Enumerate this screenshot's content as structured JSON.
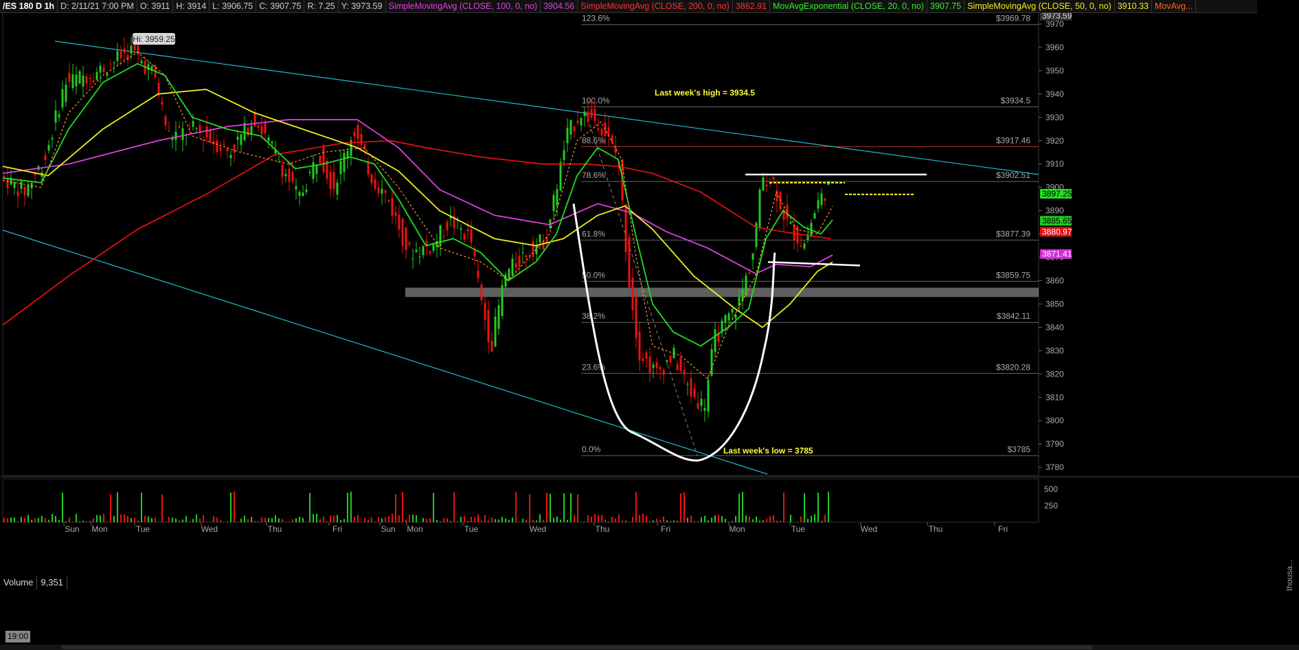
{
  "header": {
    "symbol": "/ES 180 D 1h",
    "date": "D: 2/11/21 7:00 PM",
    "open": "O: 3911",
    "high": "H: 3914",
    "low": "L: 3906.75",
    "close": "C: 3907.75",
    "range": "R: 7.25",
    "y": "Y: 3973.59",
    "sma100_label": "SimpleMovingAvg (CLOSE, 100, 0, no)",
    "sma100_value": "3904.56",
    "sma200_label": "SimpleMovingAvg (CLOSE, 200, 0, no)",
    "sma200_value": "3862.91",
    "ema20_label": "MovAvgExponential (CLOSE, 20, 0, no)",
    "ema20_value": "3907.75",
    "sma50_label": "SimpleMovingAvg (CLOSE, 50, 0, no)",
    "sma50_value": "3910.33",
    "extra_label": "MovAvg..."
  },
  "volume_panel": {
    "label": "Volume",
    "value": "9,351",
    "ticks": [
      "500",
      "250"
    ],
    "unit": "thousa..."
  },
  "time_box": "19:00",
  "colors": {
    "sma100": "#e040e0",
    "sma200": "#e01010",
    "ema20": "#22dd22",
    "sma50": "#eeee22",
    "trendline": "#22bbcc",
    "up_candle": "#22cc22",
    "down_candle": "#ee1111",
    "annotation": "#ffff33"
  },
  "chart_data": {
    "type": "candlestick",
    "title": "/ES 180 D 1h",
    "ylim": [
      3775,
      3975
    ],
    "y_ticks": [
      3780,
      3790,
      3800,
      3810,
      3820,
      3830,
      3840,
      3850,
      3860,
      3870,
      3880,
      3890,
      3900,
      3910,
      3920,
      3930,
      3940,
      3950,
      3960,
      3970
    ],
    "x_day_labels": [
      "Sun",
      "Mon",
      "Tue",
      "Wed",
      "Thu",
      "Fri",
      "Sun",
      "Mon",
      "Tue",
      "Wed",
      "Thu",
      "Fri",
      "Mon",
      "Tue",
      "Wed",
      "Thu",
      "Fri"
    ],
    "high_marker": {
      "label": "Hi: 3959.25",
      "price": 3959.25
    },
    "fib_levels": [
      {
        "pct": "123.6%",
        "price": 3969.78,
        "label": "$3969.78"
      },
      {
        "pct": "100.0%",
        "price": 3934.5,
        "label": "$3934.5"
      },
      {
        "pct": "88.6%",
        "price": 3917.46,
        "label": "$3917.46"
      },
      {
        "pct": "78.6%",
        "price": 3902.51,
        "label": "$3902.51"
      },
      {
        "pct": "61.8%",
        "price": 3877.39,
        "label": "$3877.39"
      },
      {
        "pct": "50.0%",
        "price": 3859.75,
        "label": "$3859.75"
      },
      {
        "pct": "38.2%",
        "price": 3842.11,
        "label": "$3842.11"
      },
      {
        "pct": "23.6%",
        "price": 3820.28,
        "label": "$3820.28"
      },
      {
        "pct": "0.0%",
        "price": 3785,
        "label": "$3785"
      }
    ],
    "annotations": [
      {
        "text": "Last week's high = 3934.5",
        "price": 3934.5
      },
      {
        "text": "Last week's low = 3785",
        "price": 3785
      }
    ],
    "price_tags": [
      {
        "label": "3973.59",
        "price": 3973.59
      },
      {
        "label": "3897.25",
        "price": 3897.25
      },
      {
        "label": "3885.65",
        "price": 3885.65
      },
      {
        "label": "3880.97",
        "price": 3880.97
      },
      {
        "label": "3871.41",
        "price": 3871.41
      }
    ],
    "support_zone": [
      3853,
      3857
    ],
    "series": [
      {
        "name": "SimpleMovingAvg (CLOSE, 100, 0, no)",
        "last": 3871.41
      },
      {
        "name": "SimpleMovingAvg (CLOSE, 200, 0, no)",
        "last": 3880.97
      },
      {
        "name": "MovAvgExponential (CLOSE, 20, 0, no)",
        "last": 3885.65
      },
      {
        "name": "SimpleMovingAvg (CLOSE, 50, 0, no)",
        "last": 3868
      }
    ]
  }
}
